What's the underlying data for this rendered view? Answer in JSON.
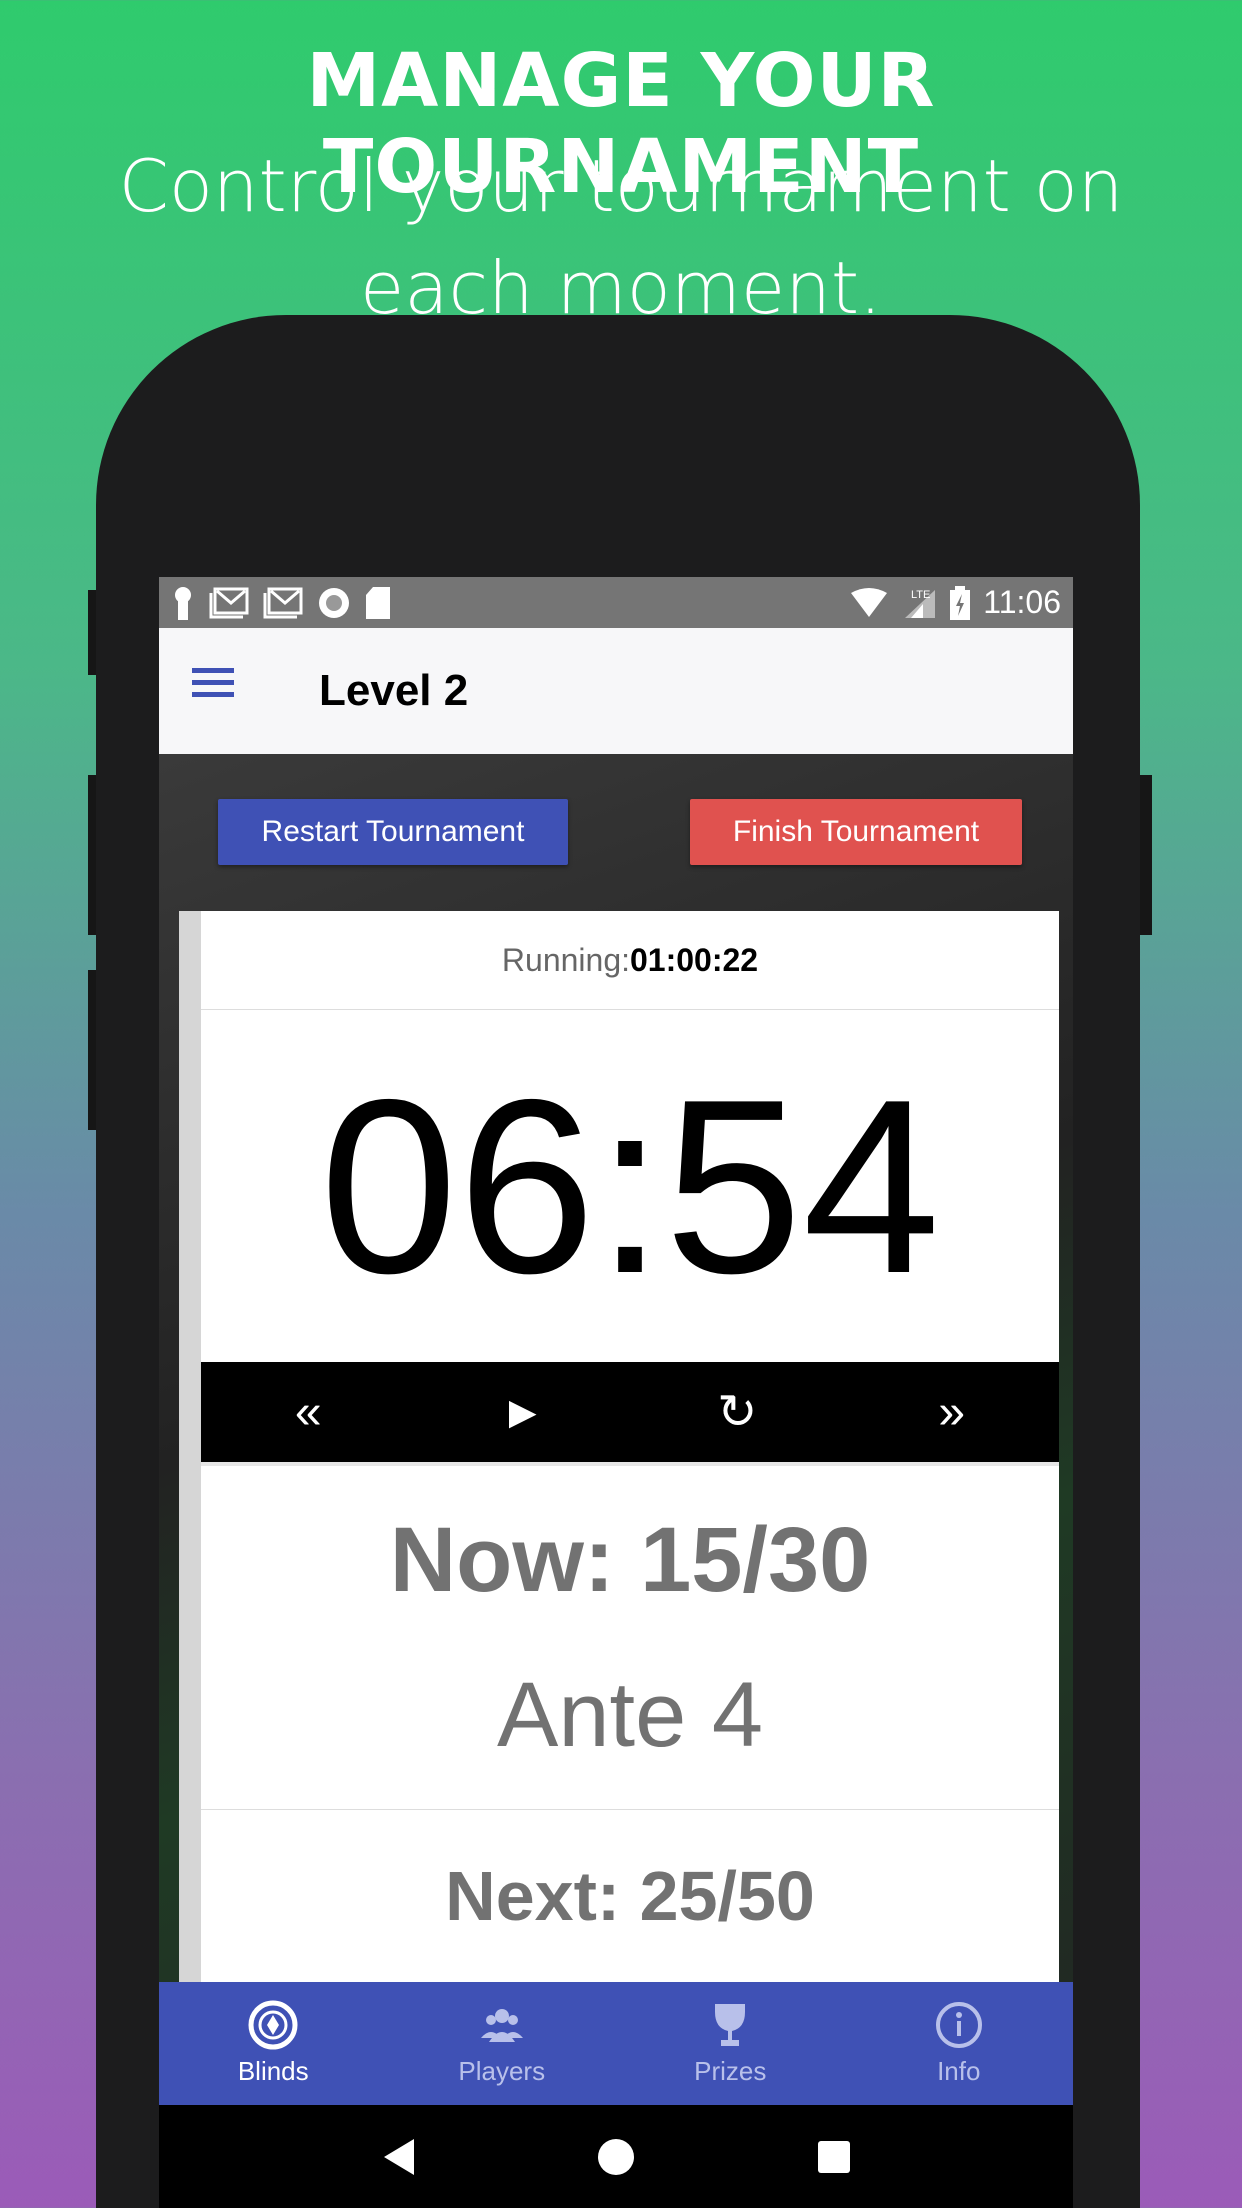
{
  "promo": {
    "headline": "MANAGE YOUR TOURNAMENT",
    "subline": "Control your tournament on each moment."
  },
  "status_bar": {
    "time": "11:06",
    "icons": [
      "keyhole-icon",
      "gmail-icon",
      "gmail-icon",
      "record-icon",
      "sd-card-icon",
      "wifi-off-icon",
      "lte-signal-icon",
      "battery-charging-icon"
    ]
  },
  "app_bar": {
    "title": "Level 2",
    "menu_icon": "hamburger-menu-icon"
  },
  "actions": {
    "restart": "Restart Tournament",
    "finish": "Finish Tournament"
  },
  "colors": {
    "primary": "#3f51b5",
    "danger": "#e0524f"
  },
  "clock": {
    "running_label": "Running:",
    "running_value": "01:00:22",
    "remaining": "06:54"
  },
  "controls": {
    "prev": "«",
    "play": "▶",
    "reset": "↻",
    "next": "»"
  },
  "blinds": {
    "now": "Now: 15/30",
    "ante": "Ante 4",
    "next": "Next: 25/50"
  },
  "bottom_nav": [
    {
      "label": "Blinds",
      "active": true
    },
    {
      "label": "Players"
    },
    {
      "label": "Prizes"
    },
    {
      "label": "Info"
    }
  ]
}
